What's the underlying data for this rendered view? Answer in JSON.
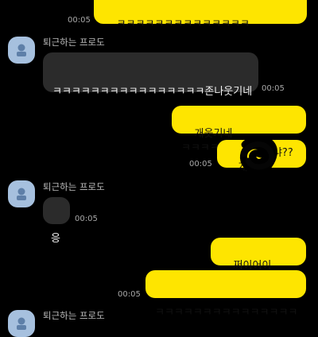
{
  "sender_name": "퇴근하는 프로도",
  "messages": [
    {
      "id": "m1",
      "direction": "out",
      "text": "ㅋㅋㅋㅋㅋㅋㅋㅋㅋㅋㅋㅋㅋㅋ",
      "time": "00:05"
    },
    {
      "id": "m2",
      "direction": "in",
      "sender": "퇴근하는 프로도",
      "text": "ㅋㅋㅋㅋㅋㅋㅋㅋㅋㅋㅋㅋㅋㅋㅋㅋ존나웃기네",
      "time": "00:05"
    },
    {
      "id": "m3",
      "direction": "out",
      "text": "개웃기네 ㅋㅋㅋㅋㅋㅋㅋㅋ",
      "time": ""
    },
    {
      "id": "m4",
      "direction": "out",
      "text_start": "개가",
      "text_end": "얘냐??",
      "time": "00:05",
      "redacted": true
    },
    {
      "id": "m5",
      "direction": "in",
      "sender": "퇴근하는 프로도",
      "text": "응",
      "time": "00:05"
    },
    {
      "id": "m6",
      "direction": "out",
      "text": "쩌이어이~~~~~~",
      "time": ""
    },
    {
      "id": "m7",
      "direction": "out",
      "text": "ㅋㅋㅋㅋㅋㅋㅋㅋㅋㅋㅋㅋㅋㅋㅋ",
      "time": "00:05"
    }
  ],
  "colors": {
    "background": "#000000",
    "outgoing_bubble": "#FEE500",
    "incoming_bubble": "#2B2B2B",
    "avatar": "#A6C0DE"
  },
  "icons": {
    "avatar": "default-profile-icon",
    "redaction": "black-scribble"
  }
}
